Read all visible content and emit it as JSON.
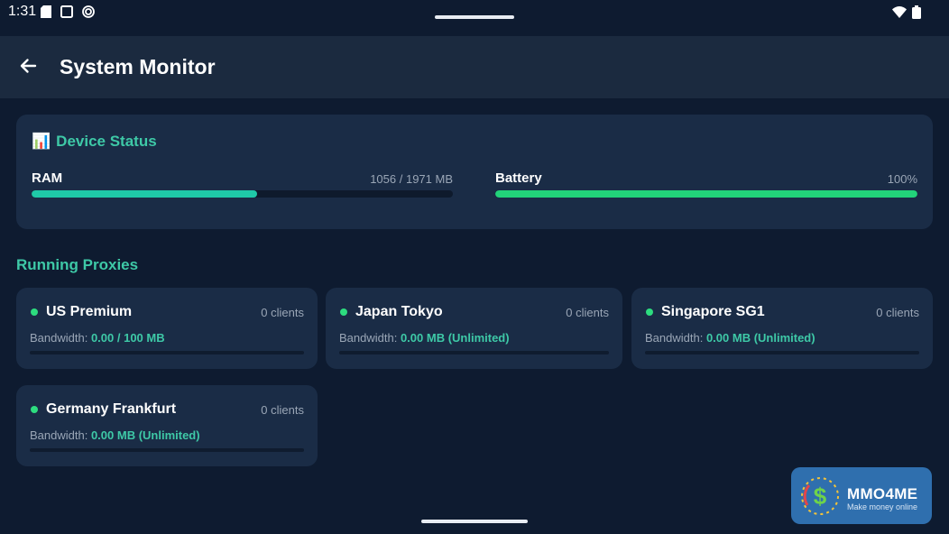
{
  "status_bar": {
    "time": "1:31",
    "left_icons": [
      "sd-card-icon",
      "screenshot-icon",
      "target-icon"
    ],
    "right_icons": [
      "wifi-icon",
      "battery-icon"
    ]
  },
  "app_bar": {
    "title": "System Monitor",
    "back_icon": "arrow-left-icon"
  },
  "device_status": {
    "emoji": "📊",
    "heading": "Device Status",
    "ram": {
      "label": "RAM",
      "value_text": "1056 / 1971 MB",
      "fraction": 0.5358
    },
    "battery": {
      "label": "Battery",
      "value_text": "100%",
      "fraction": 1.0
    }
  },
  "proxies": {
    "section_title": "Running Proxies",
    "bandwidth_prefix": "Bandwidth:",
    "items": [
      {
        "name": "US Premium",
        "clients": "0 clients",
        "bandwidth": "0.00 / 100 MB",
        "status": "online"
      },
      {
        "name": "Japan Tokyo",
        "clients": "0 clients",
        "bandwidth": "0.00 MB (Unlimited)",
        "status": "online"
      },
      {
        "name": "Singapore SG1",
        "clients": "0 clients",
        "bandwidth": "0.00 MB (Unlimited)",
        "status": "online"
      },
      {
        "name": "Germany Frankfurt",
        "clients": "0 clients",
        "bandwidth": "0.00 MB (Unlimited)",
        "status": "online"
      }
    ]
  },
  "watermark": {
    "title": "MMO4ME",
    "subtitle": "Make money online"
  },
  "colors": {
    "background": "#0e1b30",
    "app_bar": "#1b2a3f",
    "card": "#1a2c46",
    "accent": "#3ec9a7",
    "ram_bar": "#1fc9a8",
    "battery_bar": "#22d37a",
    "online_dot": "#2ddc7f"
  }
}
